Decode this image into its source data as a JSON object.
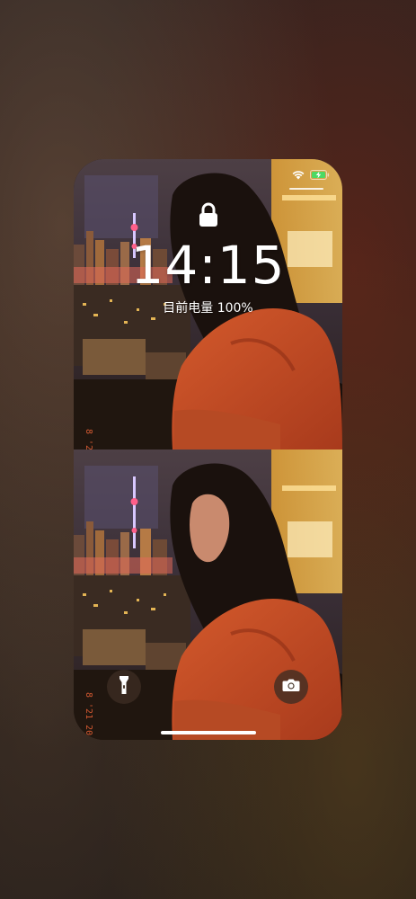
{
  "lock_screen": {
    "time": "14:15",
    "battery_status": "目前电量 100%"
  },
  "status_bar": {
    "wifi": "wifi-icon",
    "battery": "battery-charging-icon",
    "battery_level_fraction": 1.0
  },
  "quick_actions": {
    "left": "flashlight-icon",
    "right": "camera-icon"
  },
  "colors": {
    "battery_fill": "#4cd964",
    "text": "#ffffff"
  }
}
